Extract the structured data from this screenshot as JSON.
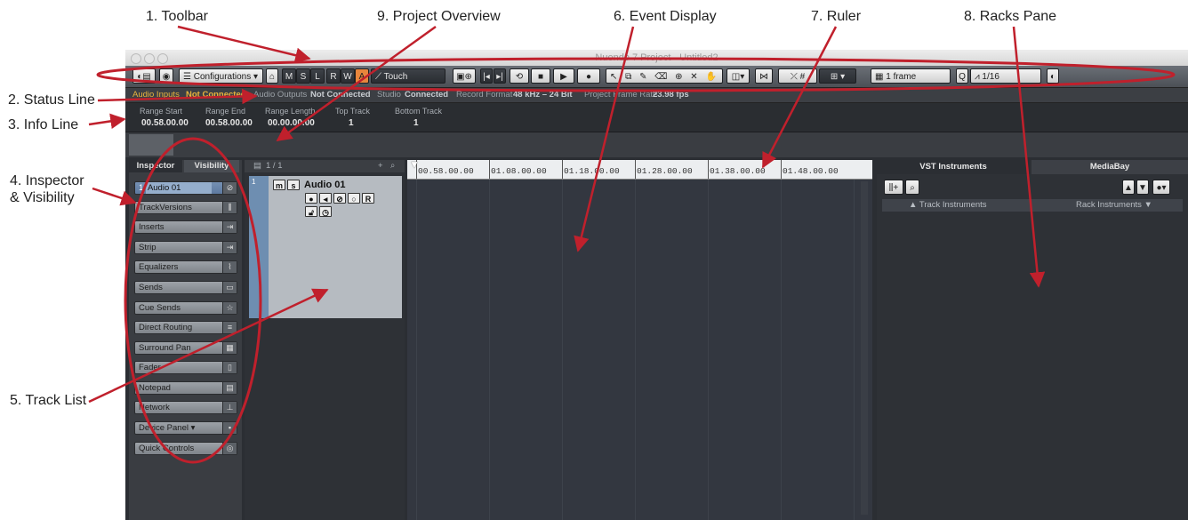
{
  "callouts": {
    "toolbar": "1. Toolbar",
    "status_line": "2. Status Line",
    "info_line": "3. Info Line",
    "inspector_a": "4. Inspector",
    "inspector_b": "& Visibility",
    "track_list": "5. Track List",
    "event_display": "6. Event Display",
    "ruler": "7. Ruler",
    "racks_pane": "8. Racks Pane",
    "project_overview": "9. Project Overview"
  },
  "window": {
    "title": "Nuendo 7 Project - Untitled2"
  },
  "toolbar": {
    "configurations": "Configurations",
    "m": "M",
    "s": "S",
    "l": "L",
    "r": "R",
    "w": "W",
    "a": "A",
    "automation_mode": "Touch",
    "grid_type": "1 frame",
    "quantize": "1/16"
  },
  "status_line": {
    "audio_inputs_label": "Audio Inputs",
    "audio_inputs_value": "Not Connected",
    "audio_outputs_label": "Audio Outputs",
    "audio_outputs_value": "Not Connected",
    "studio_label": "Studio",
    "studio_value": "Connected",
    "record_format_label": "Record Format",
    "record_format_value": "48 kHz – 24 Bit",
    "frame_rate_label": "Project Frame Rate",
    "frame_rate_value": "23.98 fps"
  },
  "info_line": [
    {
      "label": "Range Start",
      "value": "00.58.00.00"
    },
    {
      "label": "Range End",
      "value": "00.58.00.00"
    },
    {
      "label": "Range Length",
      "value": "00.00.00.00"
    },
    {
      "label": "Top Track",
      "value": "1"
    },
    {
      "label": "Bottom Track",
      "value": "1"
    }
  ],
  "inspector": {
    "tab_inspector": "Inspector",
    "tab_visibility": "Visibility",
    "track_number": "1",
    "track_name": "Audio 01",
    "sections": [
      "TrackVersions",
      "Inserts",
      "Strip",
      "Equalizers",
      "Sends",
      "Cue Sends",
      "Direct Routing",
      "Surround Pan",
      "Fader",
      "Notepad",
      "Network",
      "Device Panel",
      "Quick Controls"
    ]
  },
  "track_list": {
    "counter": "1 / 1",
    "track_number": "1",
    "track_name": "Audio 01"
  },
  "ruler": {
    "labels": [
      "00.58.00.00",
      "01.08.00.00",
      "01.18.00.00",
      "01.28.00.00",
      "01.38.00.00",
      "01.48.00.00"
    ]
  },
  "racks": {
    "tab_vst": "VST Instruments",
    "tab_mediabay": "MediaBay",
    "col_track_instruments": "▲ Track Instruments",
    "col_rack_instruments": "Rack Instruments ▼"
  },
  "colors": {
    "callout_arrow": "#c0202c",
    "accent_orange": "#e8863c",
    "status_warning": "#e8b33c",
    "track_strip": "#6e8eb1"
  }
}
